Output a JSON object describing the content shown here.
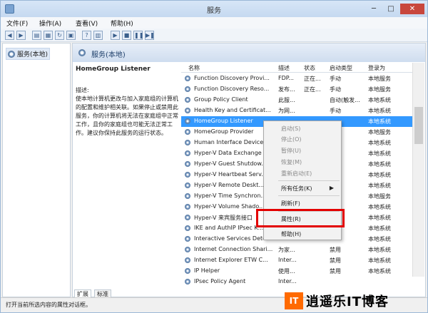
{
  "window": {
    "title": "服务"
  },
  "menubar": {
    "items": [
      "文件(F)",
      "操作(A)",
      "查看(V)",
      "帮助(H)"
    ]
  },
  "toolbar": {
    "buttons": [
      "back-icon",
      "forward-icon",
      "show-hide-icon",
      "refresh-icon",
      "export-icon",
      "help-icon",
      "view-icon",
      "play-icon",
      "stop-icon",
      "pause-icon",
      "restart-icon"
    ]
  },
  "tree": {
    "root": "服务(本地)"
  },
  "main": {
    "title": "服务(本地)"
  },
  "description": {
    "service": "HomeGroup Listener",
    "label": "描述:",
    "text": "使本地计算机更改与加入家庭组的计算机的配置和维护相关联。如果停止或禁用此服务，你的计算机将无法在家庭组中正常工作，且你的家庭组也可能无法正常工作。建议你保持此服务的运行状态。"
  },
  "table": {
    "headers": {
      "name": "名称",
      "desc": "描述",
      "status": "状态",
      "start": "启动类型",
      "logon": "登录为"
    },
    "rows": [
      [
        "Function Discovery Provi...",
        "FDP...",
        "正在...",
        "手动",
        "本地服务"
      ],
      [
        "Function Discovery Reso...",
        "发布...",
        "正在...",
        "手动",
        "本地服务"
      ],
      [
        "Group Policy Client",
        "此服...",
        "",
        "自动(触发...",
        "本地系统"
      ],
      [
        "Health Key and Certificat...",
        "为网...",
        "",
        "手动",
        "本地系统"
      ],
      [
        "HomeGroup Listener",
        "",
        "",
        "",
        "本地系统"
      ],
      [
        "HomeGroup Provider",
        "",
        "",
        "",
        "本地服务"
      ],
      [
        "Human Interface Device...",
        "",
        "",
        "",
        "本地系统"
      ],
      [
        "Hyper-V Data Exchange ...",
        "",
        "",
        "",
        "本地系统"
      ],
      [
        "Hyper-V Guest Shutdow...",
        "",
        "",
        "",
        "本地系统"
      ],
      [
        "Hyper-V Heartbeat Serv...",
        "",
        "",
        "",
        "本地系统"
      ],
      [
        "Hyper-V Remote Deskt...",
        "",
        "",
        "",
        "本地系统"
      ],
      [
        "Hyper-V Time Synchron...",
        "",
        "",
        "",
        "本地服务"
      ],
      [
        "Hyper-V Volume Shado...",
        "",
        "",
        "",
        "本地系统"
      ],
      [
        "Hyper-V 来宾服务接口",
        "",
        "",
        "",
        "本地系统"
      ],
      [
        "IKE and AuthIP IPsec K...",
        "",
        "",
        "",
        "本地系统"
      ],
      [
        "Interactive Services Dete...",
        "",
        "",
        "",
        "本地系统"
      ],
      [
        "Internet Connection Shari...",
        "为家...",
        "",
        "禁用",
        "本地系统"
      ],
      [
        "Internet Explorer ETW C...",
        "Inter...",
        "",
        "禁用",
        "本地系统"
      ],
      [
        "IP Helper",
        "使用...",
        "",
        "禁用",
        "本地系统"
      ],
      [
        "IPsec Policy Agent",
        "Inter...",
        "",
        "",
        ""
      ]
    ],
    "selected_index": 4
  },
  "context_menu": {
    "items": [
      {
        "label": "启动(S)",
        "disabled": true
      },
      {
        "label": "停止(O)",
        "disabled": true
      },
      {
        "label": "暂停(U)",
        "disabled": true
      },
      {
        "label": "恢复(M)",
        "disabled": true
      },
      {
        "label": "重新启动(E)",
        "disabled": true
      },
      {
        "label": "所有任务(K)",
        "disabled": false,
        "submenu": true
      },
      {
        "label": "刷新(F)",
        "disabled": false
      },
      {
        "label": "属性(R)",
        "disabled": false,
        "highlighted": true
      },
      {
        "label": "帮助(H)",
        "disabled": false
      }
    ]
  },
  "tabs": [
    "扩展",
    "标准"
  ],
  "status": {
    "text": "打开当前所选内容的属性对话框。"
  },
  "watermark": {
    "box": "IT",
    "text": "逍遥乐IT博客"
  },
  "colors": {
    "selection": "#3399ff",
    "highlight_frame": "#e30000",
    "watermark": "#ff6a00"
  }
}
